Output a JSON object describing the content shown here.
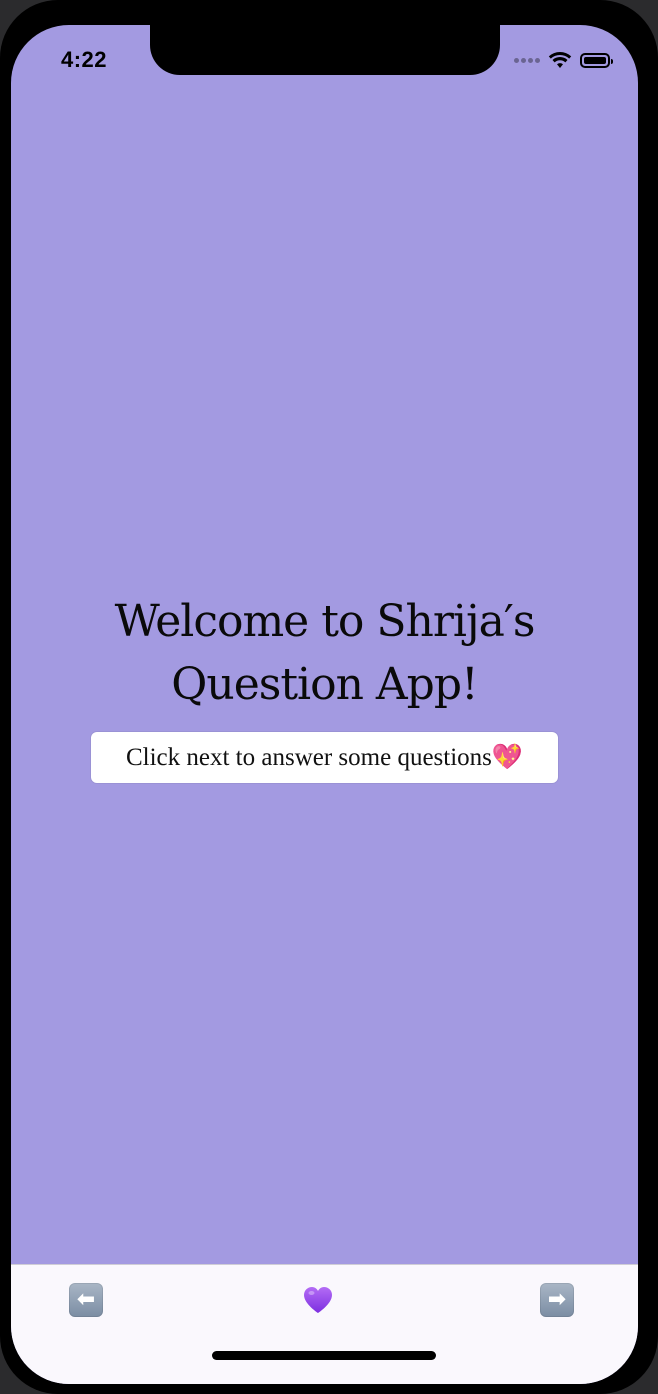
{
  "status_bar": {
    "time": "4:22",
    "icons": [
      "signal-icon",
      "wifi-icon",
      "battery-icon"
    ]
  },
  "main": {
    "title_line1": "Welcome to Shrija′s",
    "title_line2": "Question App!",
    "subtitle": "Click next to answer some questions💖"
  },
  "tab_bar": {
    "prev_glyph": "⬅",
    "heart_glyph": "💜",
    "next_glyph": "➡"
  },
  "colors": {
    "background": "#a39ae1",
    "tab_bar": "#faf8fd",
    "subtitle_box": "#ffffff"
  }
}
